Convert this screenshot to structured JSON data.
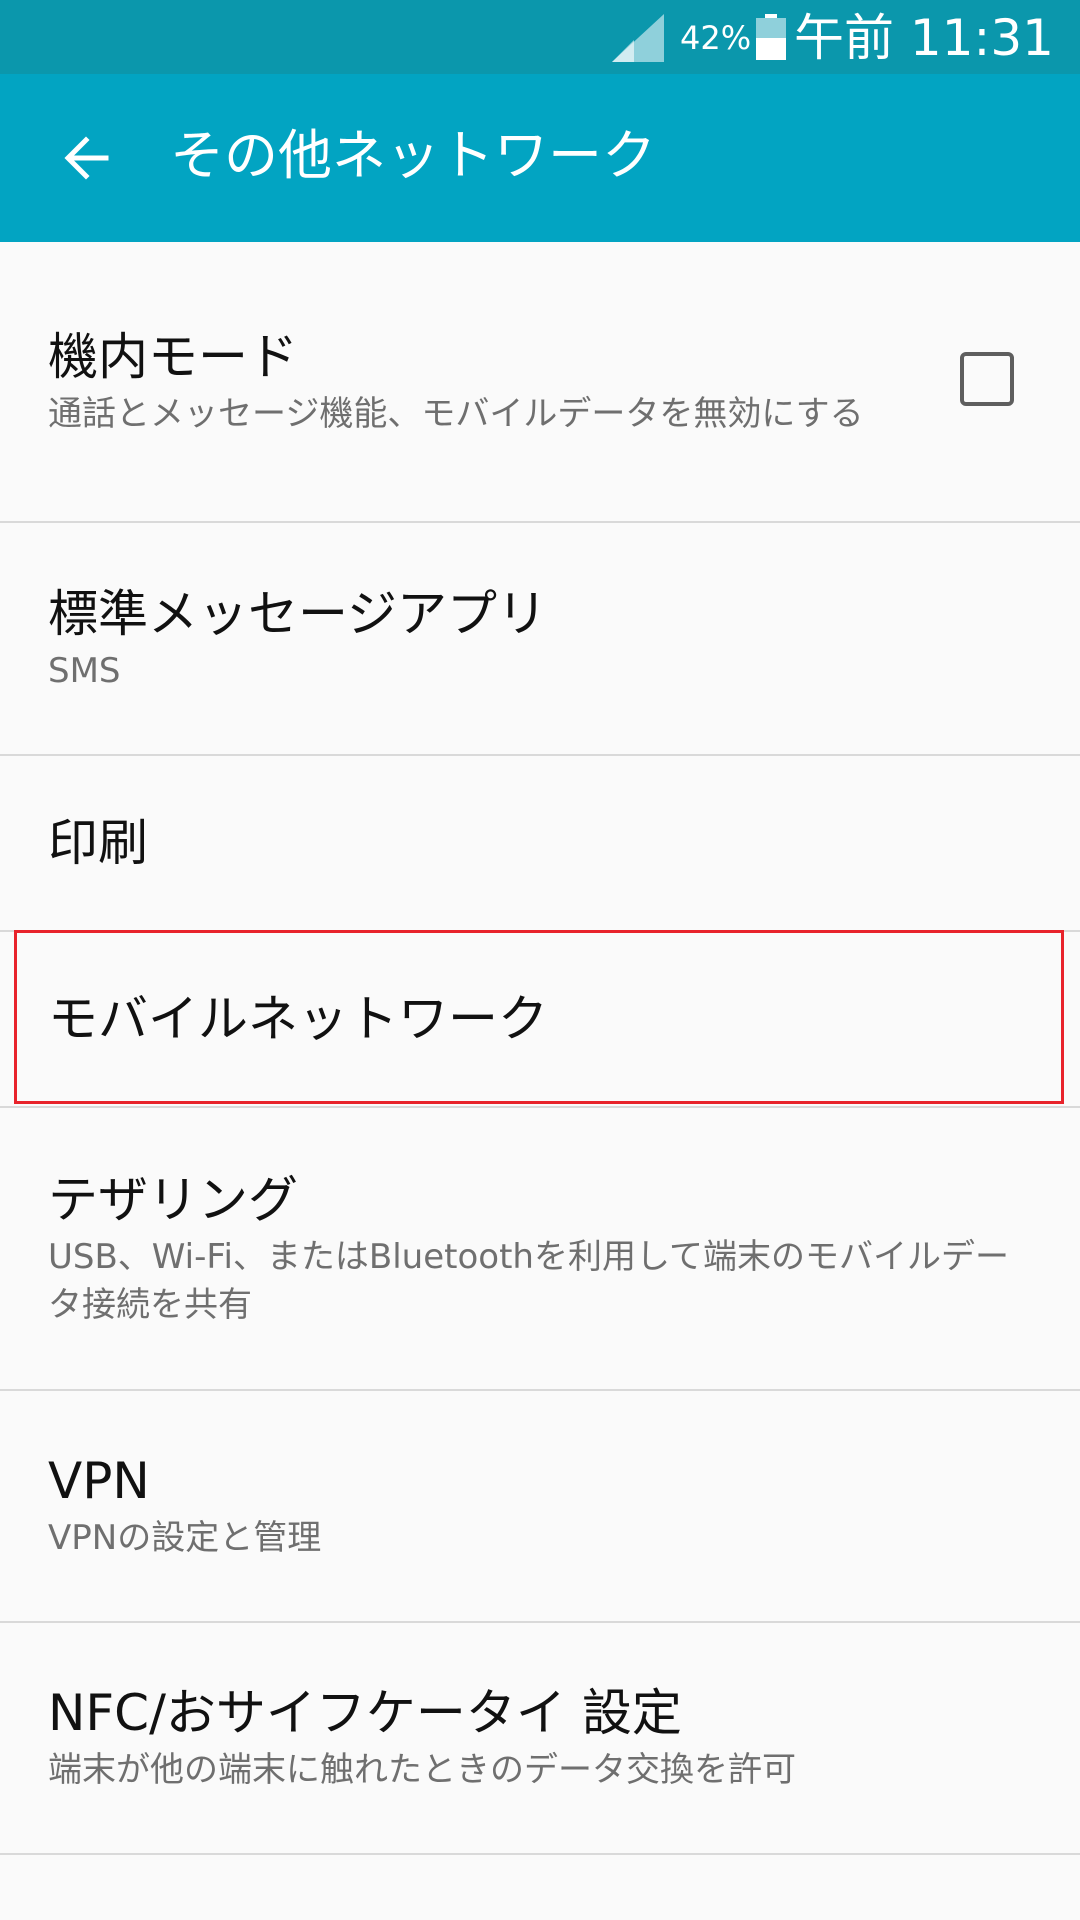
{
  "status_bar": {
    "battery_percent": "42%",
    "time": "午前 11:31"
  },
  "app_bar": {
    "title": "その他ネットワーク"
  },
  "items": [
    {
      "title": "機内モード",
      "subtitle": "通話とメッセージ機能、モバイルデータを無効にする",
      "checked": false
    },
    {
      "title": "標準メッセージアプリ",
      "subtitle": "SMS"
    },
    {
      "title": "印刷"
    },
    {
      "title": "モバイルネットワーク"
    },
    {
      "title": "テザリング",
      "subtitle": "USB、Wi-Fi、またはBluetoothを利用して端末のモバイルデータ接続を共有"
    },
    {
      "title": "VPN",
      "subtitle": "VPNの設定と管理"
    },
    {
      "title": "NFC/おサイフケータイ 設定",
      "subtitle": "端末が他の端末に触れたときのデータ交換を許可"
    }
  ],
  "colors": {
    "status_bar": "#0b97ac",
    "app_bar": "#02a4c2",
    "highlight": "#e8232b"
  }
}
